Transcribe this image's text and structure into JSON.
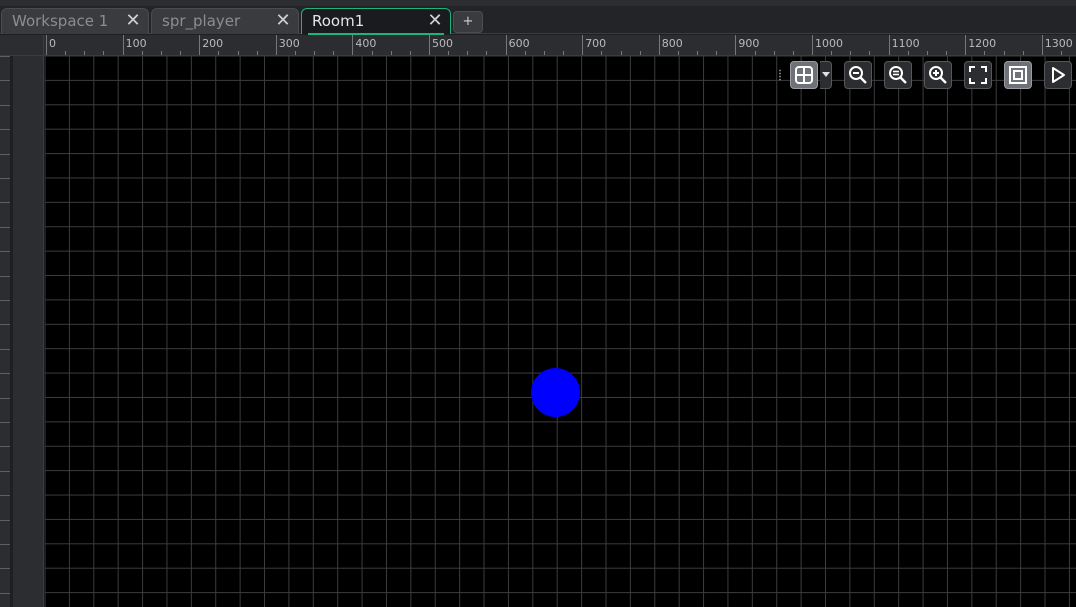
{
  "tabs": [
    {
      "label": "Workspace 1",
      "active": false
    },
    {
      "label": "spr_player",
      "active": false
    },
    {
      "label": "Room1",
      "active": true
    }
  ],
  "tab_close_glyph": "✕",
  "tab_add_label": "+",
  "ruler": {
    "labels": [
      "0",
      "100",
      "200",
      "300",
      "400",
      "500",
      "600",
      "700",
      "800",
      "900",
      "1000",
      "1100",
      "1200",
      "1300"
    ]
  },
  "room": {
    "background": "#000000",
    "grid_color": "#3c3c3c",
    "instance_color": "#0000ff"
  },
  "toolbar": {
    "buttons": [
      {
        "name": "grid-toggle-button",
        "icon": "grid-icon",
        "toggled": true
      },
      {
        "name": "grid-options-dropdown",
        "icon": "chevron-down-icon",
        "toggled": false
      },
      {
        "name": "zoom-out-button",
        "icon": "zoom-out-icon",
        "toggled": false
      },
      {
        "name": "zoom-reset-button",
        "icon": "zoom-reset-icon",
        "toggled": false
      },
      {
        "name": "zoom-in-button",
        "icon": "zoom-in-icon",
        "toggled": false
      },
      {
        "name": "fit-to-view-button",
        "icon": "fullscreen-icon",
        "toggled": false
      },
      {
        "name": "frame-toggle-button",
        "icon": "frame-icon",
        "toggled": true
      },
      {
        "name": "run-room-button",
        "icon": "play-icon",
        "toggled": false
      }
    ]
  },
  "colors": {
    "accent": "#1fb27a",
    "panel": "#2b2d30",
    "text_muted": "#8b8d91",
    "text_active": "#e6e6e6"
  }
}
